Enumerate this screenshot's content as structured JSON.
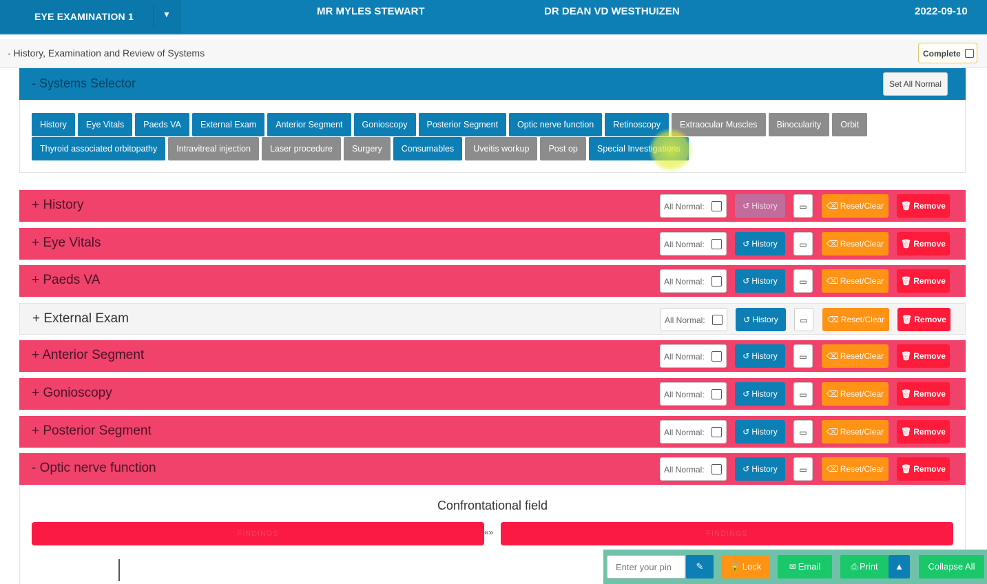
{
  "topbar": {
    "exam_name": "EYE EXAMINATION 1",
    "patient": "MR MYLES STEWART",
    "doctor": "DR DEAN VD WESTHUIZEN",
    "date": "2022-09-10"
  },
  "section": {
    "title": "- History, Examination and Review of Systems",
    "complete_label": "Complete"
  },
  "systems_selector": {
    "title": "- Systems Selector",
    "set_all_normal": "Set All Normal",
    "row1": [
      {
        "label": "History",
        "state": "active"
      },
      {
        "label": "Eye Vitals",
        "state": "active"
      },
      {
        "label": "Paeds VA",
        "state": "active"
      },
      {
        "label": "External Exam",
        "state": "active"
      },
      {
        "label": "Anterior Segment",
        "state": "active"
      },
      {
        "label": "Gonioscopy",
        "state": "active"
      },
      {
        "label": "Posterior Segment",
        "state": "active"
      },
      {
        "label": "Optic nerve function",
        "state": "active"
      },
      {
        "label": "Retinoscopy",
        "state": "active"
      },
      {
        "label": "Extraocular Muscles",
        "state": "inactive"
      },
      {
        "label": "Binocularity",
        "state": "inactive"
      },
      {
        "label": "Orbit",
        "state": "inactive"
      }
    ],
    "row2": [
      {
        "label": "Thyroid associated orbitopathy",
        "state": "active"
      },
      {
        "label": "Intravitreal injection",
        "state": "inactive"
      },
      {
        "label": "Laser procedure",
        "state": "inactive"
      },
      {
        "label": "Surgery",
        "state": "inactive"
      },
      {
        "label": "Consumables",
        "state": "active"
      },
      {
        "label": "Uveitis workup",
        "state": "inactive"
      },
      {
        "label": "Post op",
        "state": "inactive"
      },
      {
        "label": "Special Investigations",
        "state": "active"
      }
    ]
  },
  "row_controls": {
    "all_normal": "All Normal:",
    "history": "History",
    "reset": "Reset/Clear",
    "remove": "Remove"
  },
  "sections": [
    {
      "title": "+ History",
      "style": "pink"
    },
    {
      "title": "+ Eye Vitals",
      "style": "pink"
    },
    {
      "title": "+ Paeds VA",
      "style": "pink"
    },
    {
      "title": "+ External Exam",
      "style": "light"
    },
    {
      "title": "+ Anterior Segment",
      "style": "pink"
    },
    {
      "title": "+ Gonioscopy",
      "style": "pink"
    },
    {
      "title": "+ Posterior Segment",
      "style": "pink"
    },
    {
      "title": "- Optic nerve function",
      "style": "pink"
    }
  ],
  "confrontational": {
    "title": "Confrontational field",
    "left_label": "FINDINGS",
    "right_label": "FINDINGS",
    "swap": "«»"
  },
  "bottombar": {
    "pin_placeholder": "Enter your pin",
    "lock": "Lock",
    "email": "Email",
    "print": "Print",
    "collapse": "Collapse All"
  },
  "colors": {
    "primary": "#0d7fb5",
    "pink_row": "#f0426b",
    "orange": "#ff9316",
    "red": "#ff1b39",
    "green": "#1ac86a",
    "inactive_tab": "#8c8c8c"
  }
}
